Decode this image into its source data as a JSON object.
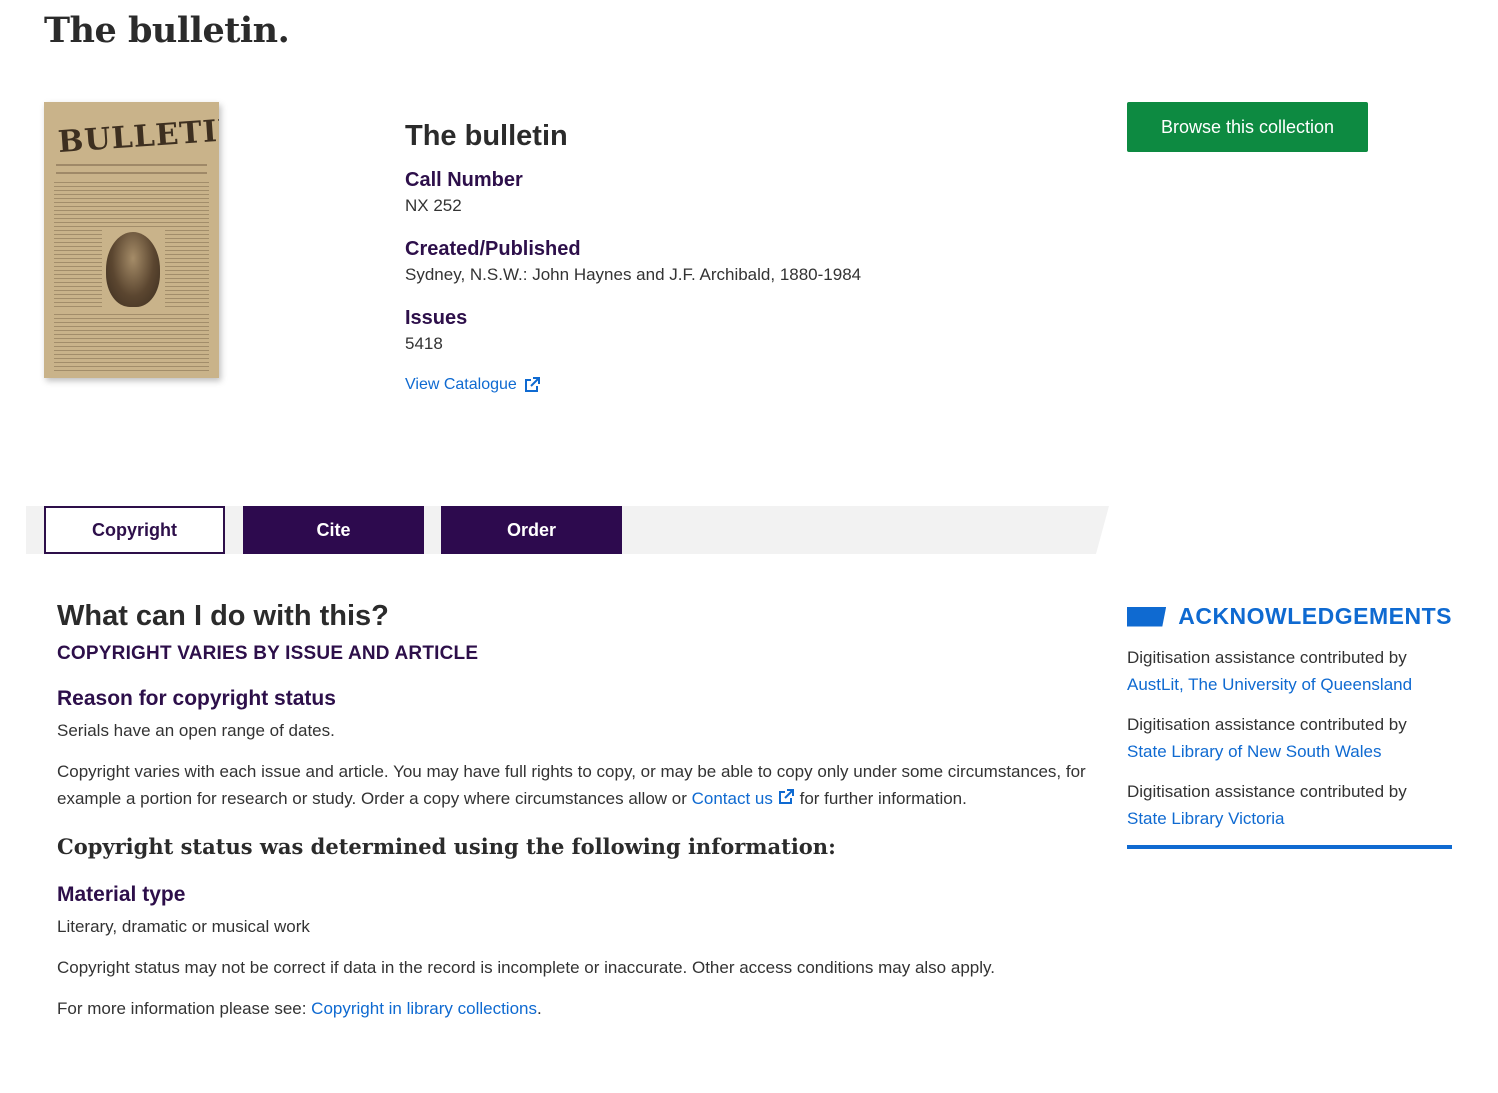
{
  "page": {
    "title": "The bulletin."
  },
  "cover": {
    "alt": "The bulletin cover",
    "masthead": "BULLETIN"
  },
  "record": {
    "title": "The bulletin",
    "call_number_label": "Call Number",
    "call_number": "NX 252",
    "created_label": "Created/Published",
    "created": "Sydney, N.S.W.: John Haynes and J.F. Archibald, 1880-1984",
    "issues_label": "Issues",
    "issues": "5418",
    "view_catalogue": "View Catalogue"
  },
  "browse_button": "Browse this collection",
  "tabs": [
    {
      "label": "Copyright",
      "active": true
    },
    {
      "label": "Cite",
      "active": false
    },
    {
      "label": "Order",
      "active": false
    }
  ],
  "copyright": {
    "heading": "What can I do with this?",
    "status": "COPYRIGHT VARIES BY ISSUE AND ARTICLE",
    "reason_label": "Reason for copyright status",
    "reason": "Serials have an open range of dates.",
    "explanation_pre": "Copyright varies with each issue and article. You may have full rights to copy, or may be able to copy only under some circumstances, for example a portion for research or study. Order a copy where circumstances allow or ",
    "contact_link": "Contact us",
    "explanation_post": " for further information.",
    "determined_heading": "Copyright status was determined using the following information:",
    "material_label": "Material type",
    "material": "Literary, dramatic or musical work",
    "disclaimer": "Copyright status may not be correct if data in the record is incomplete or inaccurate. Other access conditions may also apply.",
    "more_pre": "For more information please see: ",
    "more_link": "Copyright in library collections",
    "more_post": "."
  },
  "acknowledgements": {
    "title": "ACKNOWLEDGEMENTS",
    "items": [
      {
        "text": "Digitisation assistance contributed by",
        "link": "AustLit, The University of Queensland"
      },
      {
        "text": "Digitisation assistance contributed by",
        "link": "State Library of New South Wales"
      },
      {
        "text": "Digitisation assistance contributed by",
        "link": "State Library Victoria"
      }
    ]
  },
  "colors": {
    "purple": "#2d0f4a",
    "link_blue": "#0f6ad1",
    "green": "#0d8a41"
  }
}
